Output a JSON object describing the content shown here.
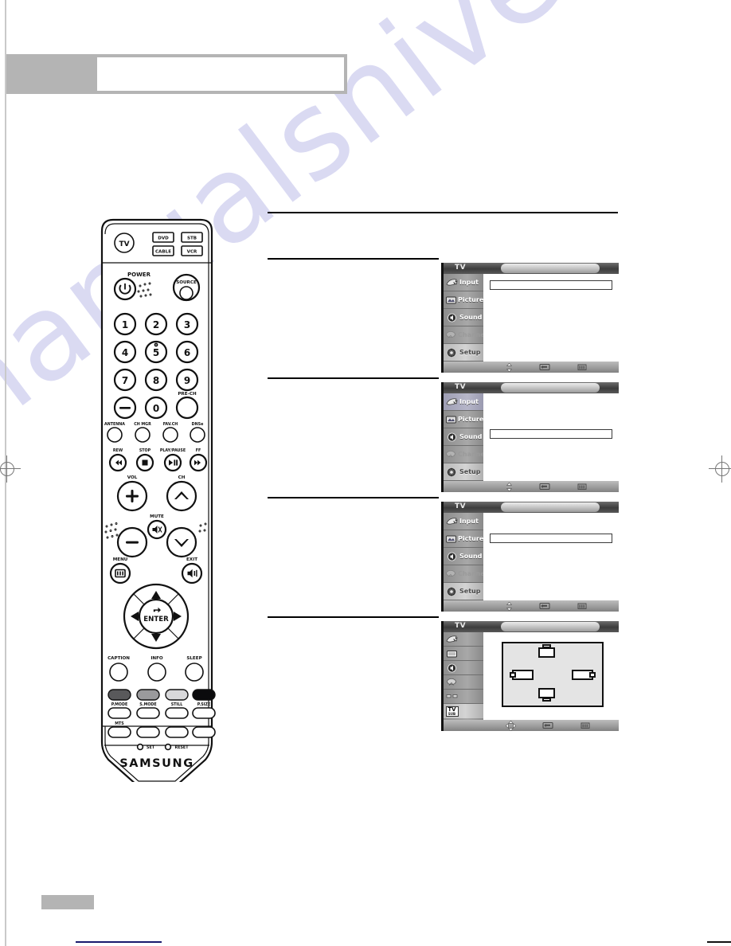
{
  "document": {
    "header_title": "",
    "page_number": "",
    "watermark_text": "manualshive.com"
  },
  "remote": {
    "brand": "SAMSUNG",
    "mode_buttons": [
      {
        "label": "TV",
        "shape": "circle"
      },
      {
        "label": "DVD",
        "shape": "rect"
      },
      {
        "label": "STB",
        "shape": "rect"
      },
      {
        "label": "CABLE",
        "shape": "rect"
      },
      {
        "label": "VCR",
        "shape": "rect"
      }
    ],
    "power_label": "POWER",
    "source_label": "SOURCE",
    "number_keys": [
      "1",
      "2",
      "3",
      "4",
      "5",
      "6",
      "7",
      "8",
      "9",
      "0"
    ],
    "minus_label": "−",
    "pre_ch_label": "PRE-CH",
    "function_row": [
      "ANTENNA",
      "CH MGR",
      "FAV.CH",
      "DNSe"
    ],
    "transport_row": [
      "REW",
      "STOP",
      "PLAY/PAUSE",
      "FF"
    ],
    "vol_label": "VOL",
    "ch_label": "CH",
    "mute_label": "MUTE",
    "menu_label": "MENU",
    "exit_label": "EXIT",
    "enter_label": "ENTER",
    "lower_row": [
      "CAPTION",
      "INFO",
      "SLEEP"
    ],
    "color_buttons": [
      {
        "label": "P.MODE",
        "color": "#59595b"
      },
      {
        "label": "S.MODE",
        "color": "#9a9a9c"
      },
      {
        "label": "STILL",
        "color": "#d8d8da"
      },
      {
        "label": "P.SIZE",
        "color": "#0b0b0d"
      }
    ],
    "mts_label": "MTS",
    "set_label": "SET",
    "reset_label": "RESET"
  },
  "osd_menus": [
    {
      "id": "menu-setup-1",
      "header_label": "TV",
      "sidebar": [
        {
          "label": "Input",
          "icon": "input-icon",
          "state": "normal"
        },
        {
          "label": "Picture",
          "icon": "picture-icon",
          "state": "normal"
        },
        {
          "label": "Sound",
          "icon": "sound-icon",
          "state": "normal"
        },
        {
          "label": "Channel",
          "icon": "channel-icon",
          "state": "disabled"
        },
        {
          "label": "Setup",
          "icon": "setup-icon",
          "state": "selected"
        }
      ],
      "highlight_row_index": null,
      "field_row_index": 0,
      "bottom_icons": [
        "move-icon",
        "enter-icon",
        "return-icon"
      ]
    },
    {
      "id": "menu-picture-2",
      "header_label": "TV",
      "sidebar": [
        {
          "label": "Input",
          "icon": "input-icon",
          "state": "normal"
        },
        {
          "label": "Picture",
          "icon": "picture-icon",
          "state": "normal"
        },
        {
          "label": "Sound",
          "icon": "sound-icon",
          "state": "normal"
        },
        {
          "label": "Channel",
          "icon": "channel-icon",
          "state": "disabled"
        },
        {
          "label": "Setup",
          "icon": "setup-icon",
          "state": "selected"
        }
      ],
      "highlight_row_index": 0,
      "field_row_index": 2,
      "bottom_icons": [
        "move-icon",
        "enter-icon",
        "return-icon"
      ]
    },
    {
      "id": "menu-setup-3",
      "header_label": "TV",
      "sidebar": [
        {
          "label": "Input",
          "icon": "input-icon",
          "state": "normal"
        },
        {
          "label": "Picture",
          "icon": "picture-icon",
          "state": "normal"
        },
        {
          "label": "Sound",
          "icon": "sound-icon",
          "state": "normal"
        },
        {
          "label": "Channel",
          "icon": "channel-icon",
          "state": "disabled"
        },
        {
          "label": "Setup",
          "icon": "setup-icon",
          "state": "selected"
        }
      ],
      "highlight_row_index": null,
      "field_row_index": 1,
      "bottom_icons": [
        "move-icon",
        "enter-icon",
        "return-icon"
      ]
    },
    {
      "id": "menu-pip-position-4",
      "header_label": "TV",
      "sidebar": [
        {
          "label": "",
          "icon": "input-icon",
          "state": "normal"
        },
        {
          "label": "",
          "icon": "picture-icon",
          "state": "normal"
        },
        {
          "label": "",
          "icon": "sound-icon",
          "state": "normal"
        },
        {
          "label": "",
          "icon": "channel-icon",
          "state": "normal"
        },
        {
          "label": "",
          "icon": "setup-icon",
          "state": "normal"
        },
        {
          "label": "",
          "icon": "tv-sub-icon",
          "state": "selected"
        }
      ],
      "pip_diagram": {
        "positions": [
          "top-center",
          "left-center",
          "right-center",
          "bottom-center"
        ]
      },
      "bottom_icons": [
        "move-4way-icon",
        "enter-icon",
        "return-icon"
      ]
    }
  ]
}
